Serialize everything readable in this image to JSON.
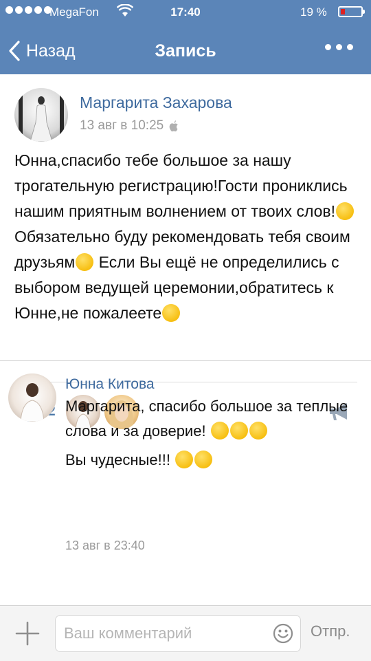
{
  "status_bar": {
    "carrier": "MegaFon",
    "time": "17:40",
    "battery_pct": "19 %"
  },
  "nav": {
    "back_label": "Назад",
    "title": "Запись"
  },
  "post": {
    "author": "Маргарита Захарова",
    "date": "13 авг в 10:25",
    "text_parts": [
      "Юнна,спасибо тебе большое за нашу трогательную регистрацию!Гости прониклись нашим приятным волнением от твоих слов!",
      " Обязательно буду рекомендовать тебя своим друзьям",
      " Если Вы ещё не определились с выбором ведущей церемонии,обратитесь к Юнне,не пожалеете"
    ],
    "likes_count": "2"
  },
  "comment": {
    "author": "Юнна Китова",
    "text_line1": "Маргарита, спасибо большое за теплые слова и за доверие!",
    "text_line2": "Вы чудесные!!!",
    "date": "13 авг в 23:40"
  },
  "composer": {
    "placeholder": "Ваш комментарий",
    "send_label": "Отпр."
  },
  "colors": {
    "nav_bg": "#5b85b8",
    "link_blue": "#3e6a9e"
  }
}
